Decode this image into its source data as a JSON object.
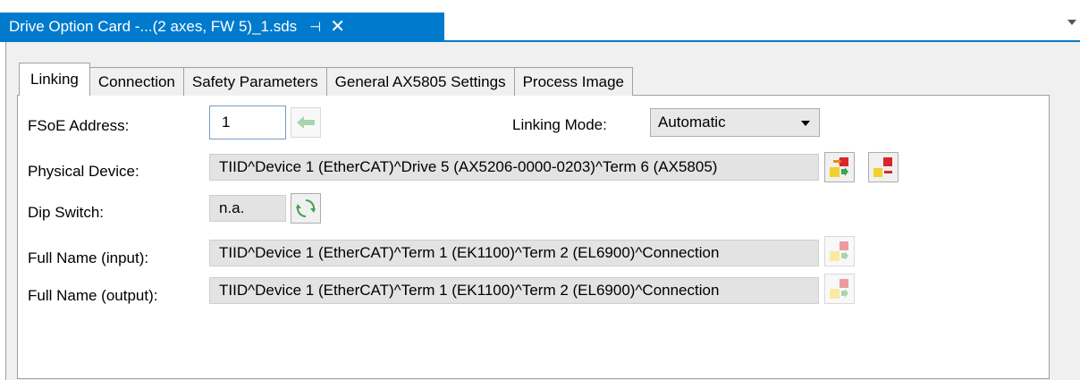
{
  "document_tab": {
    "title": "Drive Option Card -...(2 axes, FW 5)_1.sds",
    "pin": "⊣",
    "close": "✕"
  },
  "tabs": [
    "Linking",
    "Connection",
    "Safety Parameters",
    "General AX5805 Settings",
    "Process Image"
  ],
  "fsoe_address": {
    "label": "FSoE Address:",
    "value": "1"
  },
  "linking_mode": {
    "label": "Linking Mode:",
    "value": "Automatic"
  },
  "physical_device": {
    "label": "Physical Device:",
    "value": "TIID^Device 1 (EtherCAT)^Drive 5 (AX5206-0000-0203)^Term 6 (AX5805)"
  },
  "dip_switch": {
    "label": "Dip Switch:",
    "value": "n.a."
  },
  "full_name_input": {
    "label": "Full Name (input):",
    "value": "TIID^Device 1 (EtherCAT)^Term 1 (EK1100)^Term 2 (EL6900)^Connection"
  },
  "full_name_output": {
    "label": "Full Name (output):",
    "value": "TIID^Device 1 (EtherCAT)^Term 1 (EK1100)^Term 2 (EL6900)^Connection"
  },
  "colors": {
    "accent": "#007acc",
    "field_bg": "#e3e3e3",
    "panel_bg": "#f0f0f0"
  }
}
